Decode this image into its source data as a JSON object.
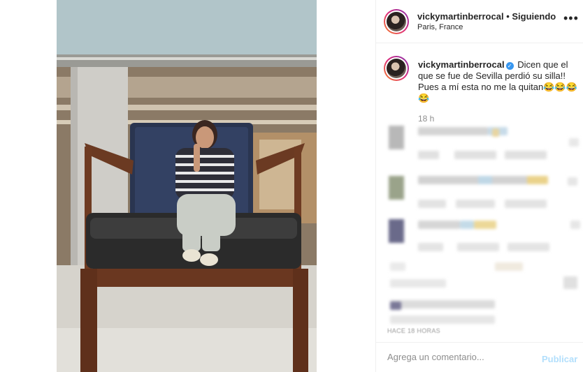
{
  "post": {
    "username": "vickymartinberrocal",
    "follow_status": "• Siguiendo",
    "location": "Paris, France",
    "more_icon": "more-horizontal-icon"
  },
  "caption": {
    "username": "vickymartinberrocal",
    "verified_icon": "verified-badge-icon",
    "text": "Dicen que el que se fue de Sevilla perdió su silla!! Pues a mí esta no me la quitan😂😂😂😂",
    "time": "18 h"
  },
  "comments_footer": {
    "timestamp": "HACE 18 HORAS"
  },
  "comment_box": {
    "placeholder": "Agrega un comentario...",
    "publish_label": "Publicar"
  },
  "colors": {
    "accent_disabled": "#b2dffc",
    "verified": "#3897f0",
    "secondary_text": "#8e8e8e"
  }
}
